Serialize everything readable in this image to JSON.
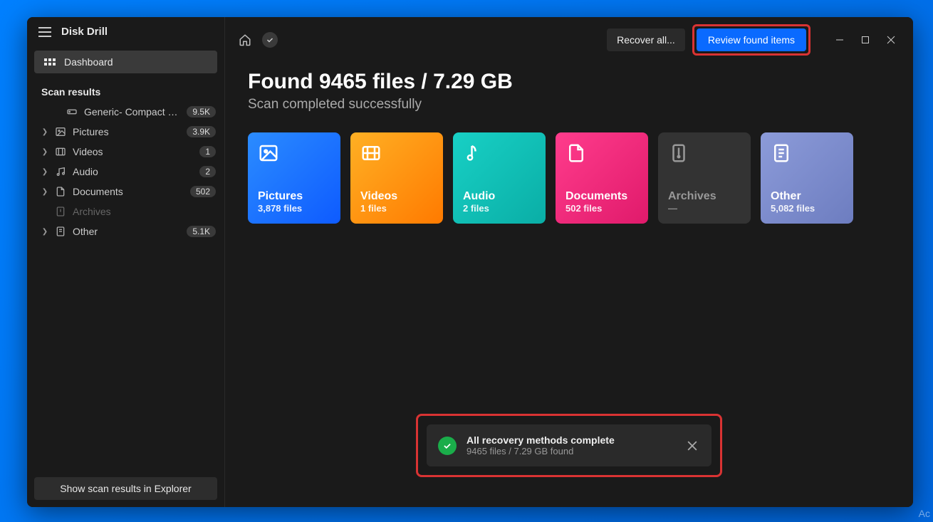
{
  "app_title": "Disk Drill",
  "sidebar": {
    "dashboard_label": "Dashboard",
    "section_label": "Scan results",
    "items": [
      {
        "label": "Generic- Compact Flash...",
        "badge": "9.5K",
        "icon": "drive",
        "expandable": false
      },
      {
        "label": "Pictures",
        "badge": "3.9K",
        "icon": "image",
        "expandable": true
      },
      {
        "label": "Videos",
        "badge": "1",
        "icon": "video",
        "expandable": true
      },
      {
        "label": "Audio",
        "badge": "2",
        "icon": "audio",
        "expandable": true
      },
      {
        "label": "Documents",
        "badge": "502",
        "icon": "doc",
        "expandable": true
      },
      {
        "label": "Archives",
        "badge": "",
        "icon": "archive",
        "expandable": false,
        "disabled": true
      },
      {
        "label": "Other",
        "badge": "5.1K",
        "icon": "other",
        "expandable": true
      }
    ],
    "footer_button": "Show scan results in Explorer"
  },
  "topbar": {
    "recover_label": "Recover all...",
    "review_label": "Review found items"
  },
  "heading": "Found 9465 files / 7.29 GB",
  "subtitle": "Scan completed successfully",
  "cards": [
    {
      "title": "Pictures",
      "sub": "3,878 files",
      "class": "c-pictures",
      "icon": "image"
    },
    {
      "title": "Videos",
      "sub": "1 files",
      "class": "c-videos",
      "icon": "video"
    },
    {
      "title": "Audio",
      "sub": "2 files",
      "class": "c-audio",
      "icon": "audio"
    },
    {
      "title": "Documents",
      "sub": "502 files",
      "class": "c-docs",
      "icon": "doc"
    },
    {
      "title": "Archives",
      "sub": "—",
      "class": "c-arch",
      "icon": "archive"
    },
    {
      "title": "Other",
      "sub": "5,082 files",
      "class": "c-other",
      "icon": "other"
    }
  ],
  "toast": {
    "title": "All recovery methods complete",
    "sub": "9465 files / 7.29 GB found"
  },
  "watermark": "Ac"
}
